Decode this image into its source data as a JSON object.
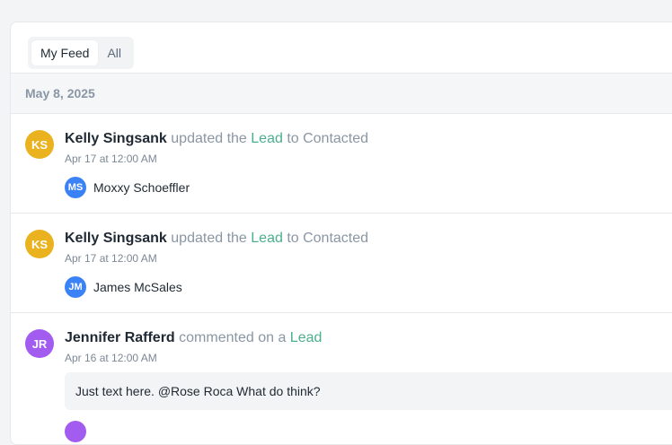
{
  "tabs": [
    {
      "label": "My Feed",
      "active": true
    },
    {
      "label": "All",
      "active": false
    }
  ],
  "date_header": "May 8, 2025",
  "feed": [
    {
      "avatar_initials": "KS",
      "avatar_color": "#ebb21f",
      "actor": "Kelly Singsank",
      "verb": "updated the",
      "object": "Lead",
      "suffix": "to Contacted",
      "timestamp": "Apr 17 at 12:00 AM",
      "owner_initials": "MS",
      "owner_name": "Moxxy Schoeffler"
    },
    {
      "avatar_initials": "KS",
      "avatar_color": "#ebb21f",
      "actor": "Kelly Singsank",
      "verb": "updated the",
      "object": "Lead",
      "suffix": "to Contacted",
      "timestamp": "Apr 17 at 12:00 AM",
      "owner_initials": "JM",
      "owner_name": "James McSales"
    },
    {
      "avatar_initials": "JR",
      "avatar_color": "#a35cf0",
      "actor": "Jennifer Rafferd",
      "verb": "commented on a",
      "object": "Lead",
      "timestamp": "Apr 16 at 12:00 AM",
      "comment": "Just text here. @Rose Roca What do think?"
    }
  ],
  "colors": {
    "link": "#4bae8f",
    "muted": "#8a96a4",
    "owner_avatar": "#3b82f6"
  }
}
